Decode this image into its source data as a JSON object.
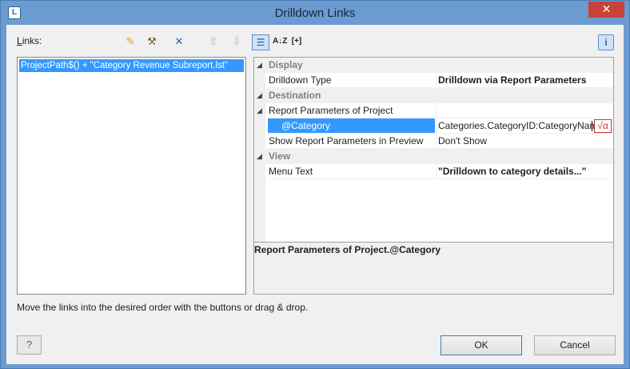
{
  "window": {
    "title": "Drilldown Links",
    "close_glyph": "✕"
  },
  "left": {
    "links_label_prefix": "L",
    "links_label_rest": "inks:",
    "toolbar": [
      {
        "name": "new-link-icon",
        "glyph": "✎"
      },
      {
        "name": "edit-link-icon",
        "glyph": "⚒"
      },
      {
        "name": "delete-link-icon",
        "glyph": "✕"
      },
      {
        "name": "move-up-icon",
        "glyph": "⇧"
      },
      {
        "name": "move-down-icon",
        "glyph": "⇩"
      }
    ],
    "items": [
      "ProjectPath$() + \"Category Revenue Subreport.lst\""
    ],
    "hint": "Move the links into the desired order with the buttons or drag & drop."
  },
  "grid": {
    "sort_cat_glyph": "☰",
    "sort_az_glyph": "A↓Z",
    "expand_glyph": "[+]",
    "info_glyph": "i",
    "rows": [
      {
        "type": "category",
        "name": "Display"
      },
      {
        "type": "prop",
        "name": "Drilldown Type",
        "value": "Drilldown via Report Parameters",
        "bold": true
      },
      {
        "type": "category",
        "name": "Destination"
      },
      {
        "type": "prop",
        "name": "Report Parameters of Project",
        "value": ""
      },
      {
        "type": "selected",
        "name": "@Category",
        "value": "Categories.CategoryID:CategoryName"
      },
      {
        "type": "prop",
        "name": "Show Report Parameters in Preview",
        "value": "Don't Show"
      },
      {
        "type": "category",
        "name": "View"
      },
      {
        "type": "prop",
        "name": "Menu Text",
        "value": "\"Drilldown to category details...\"",
        "bold": true
      }
    ],
    "formula_glyph": "√α",
    "description_title": "Report Parameters of Project.@Category"
  },
  "buttons": {
    "help_glyph": "?",
    "ok": "OK",
    "cancel": "Cancel"
  },
  "colors": {
    "selection": "#3399ff",
    "titlebar": "#6b9bd1",
    "formula_red": "#c0392b"
  }
}
